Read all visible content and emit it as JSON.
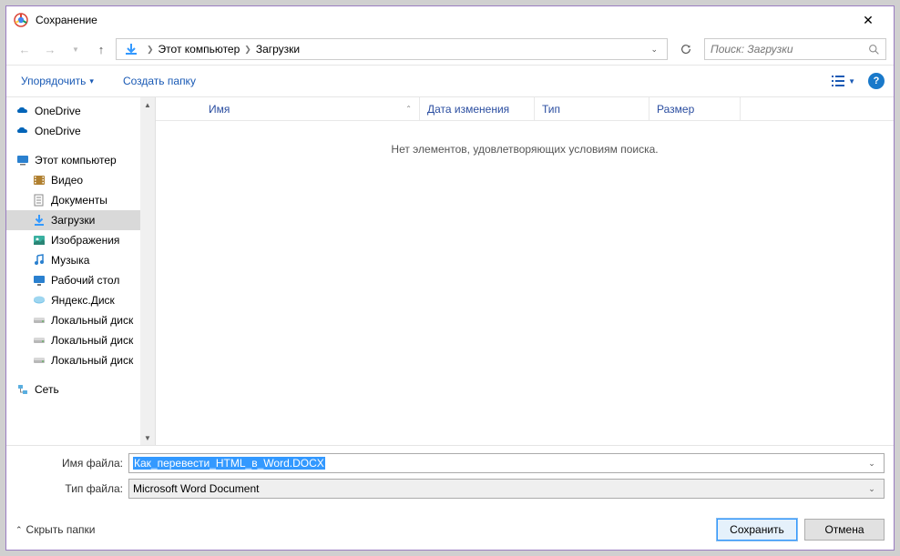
{
  "title": "Сохранение",
  "breadcrumb": {
    "root": "Этот компьютер",
    "folder": "Загрузки"
  },
  "search": {
    "placeholder": "Поиск: Загрузки"
  },
  "toolbar": {
    "organize": "Упорядочить",
    "newfolder": "Создать папку"
  },
  "columns": {
    "name": "Имя",
    "date": "Дата изменения",
    "type": "Тип",
    "size": "Размер"
  },
  "empty": "Нет элементов, удовлетворяющих условиям поиска.",
  "tree": {
    "onedrive1": "OneDrive",
    "onedrive2": "OneDrive",
    "thispc": "Этот компьютер",
    "video": "Видео",
    "docs": "Документы",
    "downloads": "Загрузки",
    "pictures": "Изображения",
    "music": "Музыка",
    "desktop": "Рабочий стол",
    "yadisk": "Яндекс.Диск",
    "disk1": "Локальный диск",
    "disk2": "Локальный диск",
    "disk3": "Локальный диск",
    "network": "Сеть"
  },
  "fields": {
    "name_label": "Имя файла:",
    "name_value": "Как_перевести_HTML_в_Word.DOCX",
    "type_label": "Тип файла:",
    "type_value": "Microsoft Word Document"
  },
  "footer": {
    "hide": "Скрыть папки",
    "save": "Сохранить",
    "cancel": "Отмена"
  }
}
